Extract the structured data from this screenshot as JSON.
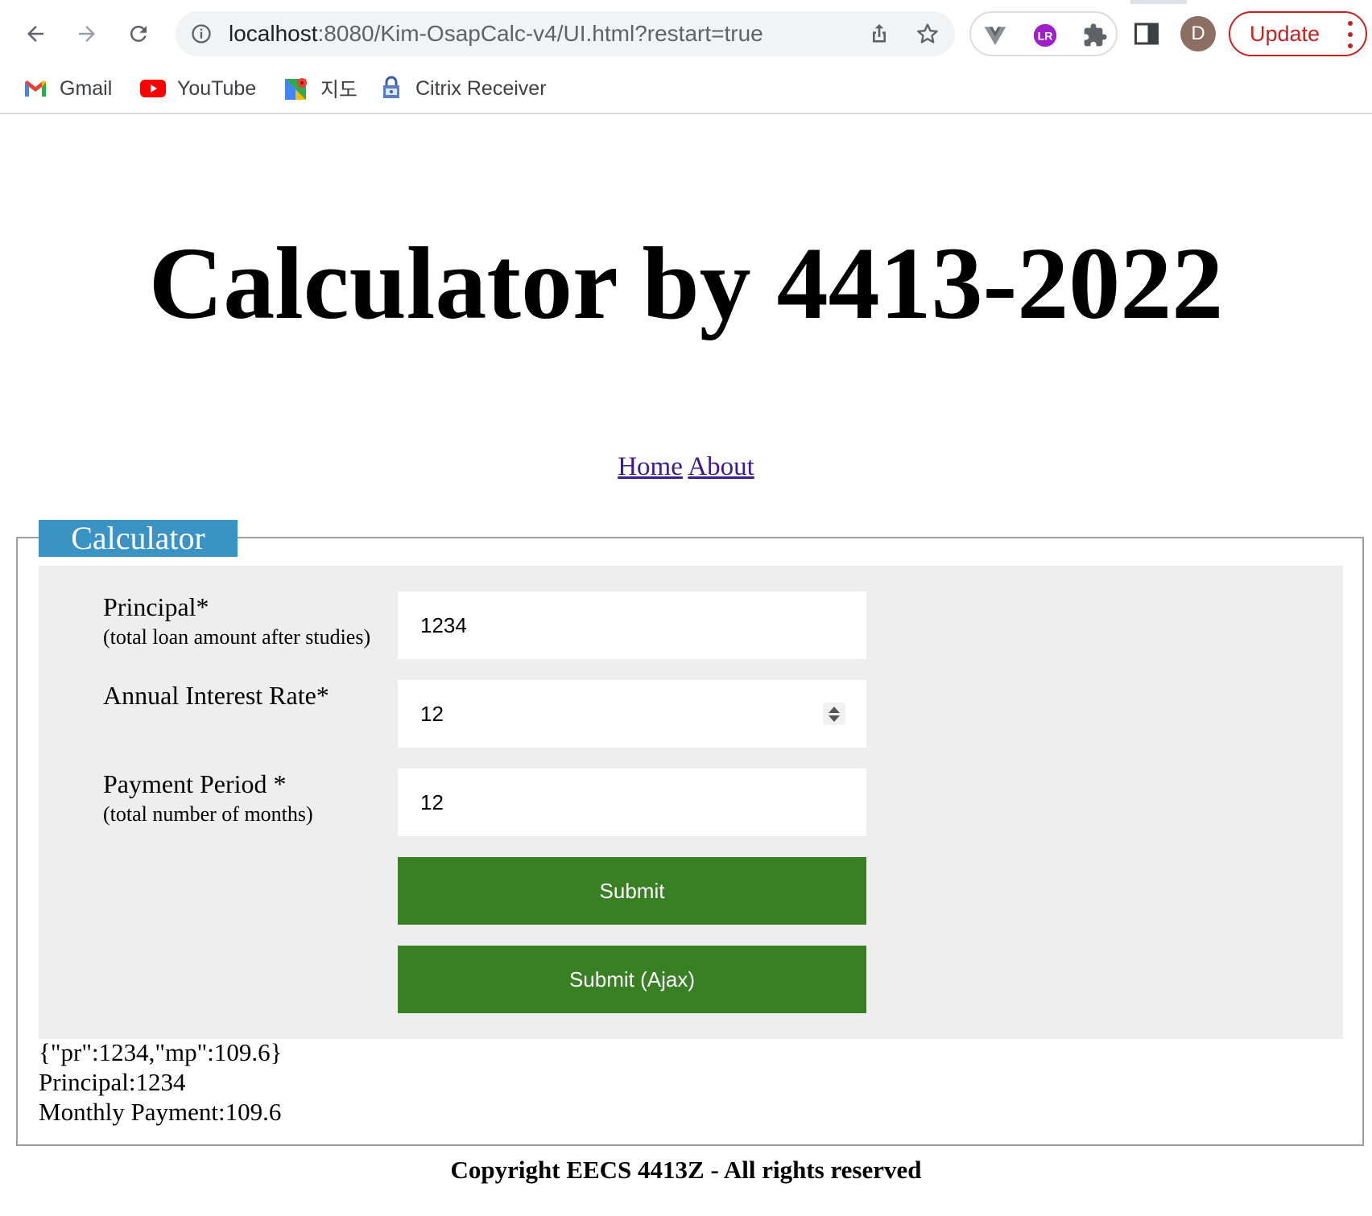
{
  "browser": {
    "url_host": "localhost",
    "url_path": ":8080/Kim-OsapCalc-v4/UI.html?restart=true",
    "profile_initial": "D",
    "update_label": "Update",
    "icons": [
      "back-icon",
      "forward-icon",
      "reload-icon",
      "info-icon",
      "share-icon",
      "star-icon",
      "vue-devtools-icon",
      "extension-lr-icon",
      "puzzle-icon",
      "side-panel-icon",
      "kebab-menu-icon"
    ],
    "bookmarks": [
      {
        "label": "Gmail",
        "icon": "gmail-icon"
      },
      {
        "label": "YouTube",
        "icon": "youtube-icon"
      },
      {
        "label": "지도",
        "icon": "maps-icon"
      },
      {
        "label": "Citrix Receiver",
        "icon": "citrix-icon"
      }
    ]
  },
  "page": {
    "title": "Calculator by 4413-2022",
    "nav": {
      "home": "Home",
      "about": "About"
    },
    "legend": "Calculator",
    "form": {
      "principal_label": "Principal*",
      "principal_hint": "(total loan amount after studies)",
      "principal_value": "1234",
      "interest_label": "Annual Interest Rate*",
      "interest_value": "12",
      "period_label": "Payment Period *",
      "period_hint": "(total number of months)",
      "period_value": "12",
      "submit_label": "Submit",
      "submit_ajax_label": "Submit (Ajax)"
    },
    "result": {
      "json_line": "{\"pr\":1234,\"mp\":109.6}",
      "principal_line": "Principal:1234",
      "payment_line": "Monthly Payment:109.6"
    },
    "footer": "Copyright EECS 4413Z - All rights reserved"
  },
  "colors": {
    "legend_bg": "#3b93c4",
    "button_bg": "#388023",
    "panel_bg": "#eeeeee",
    "update_red": "#c5221f"
  }
}
